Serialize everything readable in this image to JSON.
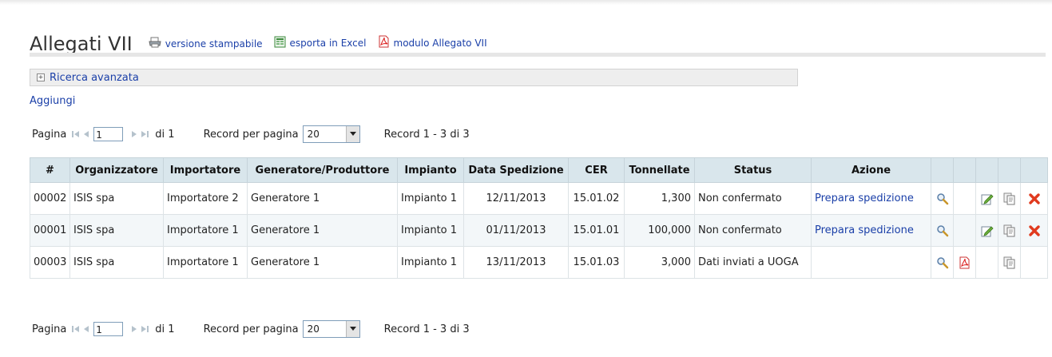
{
  "header": {
    "title": "Allegati VII",
    "links": [
      {
        "label": "versione stampabile",
        "icon": "printer-icon"
      },
      {
        "label": "esporta in Excel",
        "icon": "excel-icon"
      },
      {
        "label": "modulo Allegato VII",
        "icon": "pdf-icon"
      }
    ]
  },
  "search": {
    "toggle_symbol": "+",
    "label": "Ricerca avanzata"
  },
  "actions": {
    "add_label": "Aggiungi"
  },
  "pager_top": {
    "page_label": "Pagina",
    "page_value": "1",
    "of_label": "di 1",
    "per_page_label": "Record per pagina",
    "per_page_value": "20",
    "records_label": "Record 1 - 3 di 3"
  },
  "pager_bottom": {
    "page_label": "Pagina",
    "page_value": "1",
    "of_label": "di 1",
    "per_page_label": "Record per pagina",
    "per_page_value": "20",
    "records_label": "Record 1 - 3 di 3"
  },
  "table": {
    "columns": [
      "#",
      "Organizzatore",
      "Importatore",
      "Generatore/Produttore",
      "Impianto",
      "Data Spedizione",
      "CER",
      "Tonnellate",
      "Status",
      "Azione"
    ],
    "rows": [
      {
        "id": "00002",
        "organizzatore": "ISIS spa",
        "importatore": "Importatore 2",
        "generatore": "Generatore 1",
        "impianto": "Impianto 1",
        "data": "12/11/2013",
        "cer": "15.01.02",
        "tonnellate": "1,300",
        "status": "Non confermato",
        "azione": "Prepara spedizione",
        "icons": [
          "view-icon",
          "",
          "edit-icon",
          "copy-icon",
          "delete-icon"
        ]
      },
      {
        "id": "00001",
        "organizzatore": "ISIS spa",
        "importatore": "Importatore 1",
        "generatore": "Generatore 1",
        "impianto": "Impianto 1",
        "data": "01/11/2013",
        "cer": "15.01.01",
        "tonnellate": "100,000",
        "status": "Non confermato",
        "azione": "Prepara spedizione",
        "icons": [
          "view-icon",
          "",
          "edit-icon",
          "copy-icon",
          "delete-icon"
        ]
      },
      {
        "id": "00003",
        "organizzatore": "ISIS spa",
        "importatore": "Importatore 1",
        "generatore": "Generatore 1",
        "impianto": "Impianto 1",
        "data": "13/11/2013",
        "cer": "15.01.03",
        "tonnellate": "3,000",
        "status": "Dati inviati a UOGA",
        "azione": "",
        "icons": [
          "view-icon",
          "pdf-icon",
          "",
          "copy-icon",
          ""
        ]
      }
    ]
  },
  "colors": {
    "link": "#1a3fa8",
    "header_bg": "#d9e6ec",
    "alt_row": "#f3f7f9",
    "delete": "#e03a1e"
  }
}
